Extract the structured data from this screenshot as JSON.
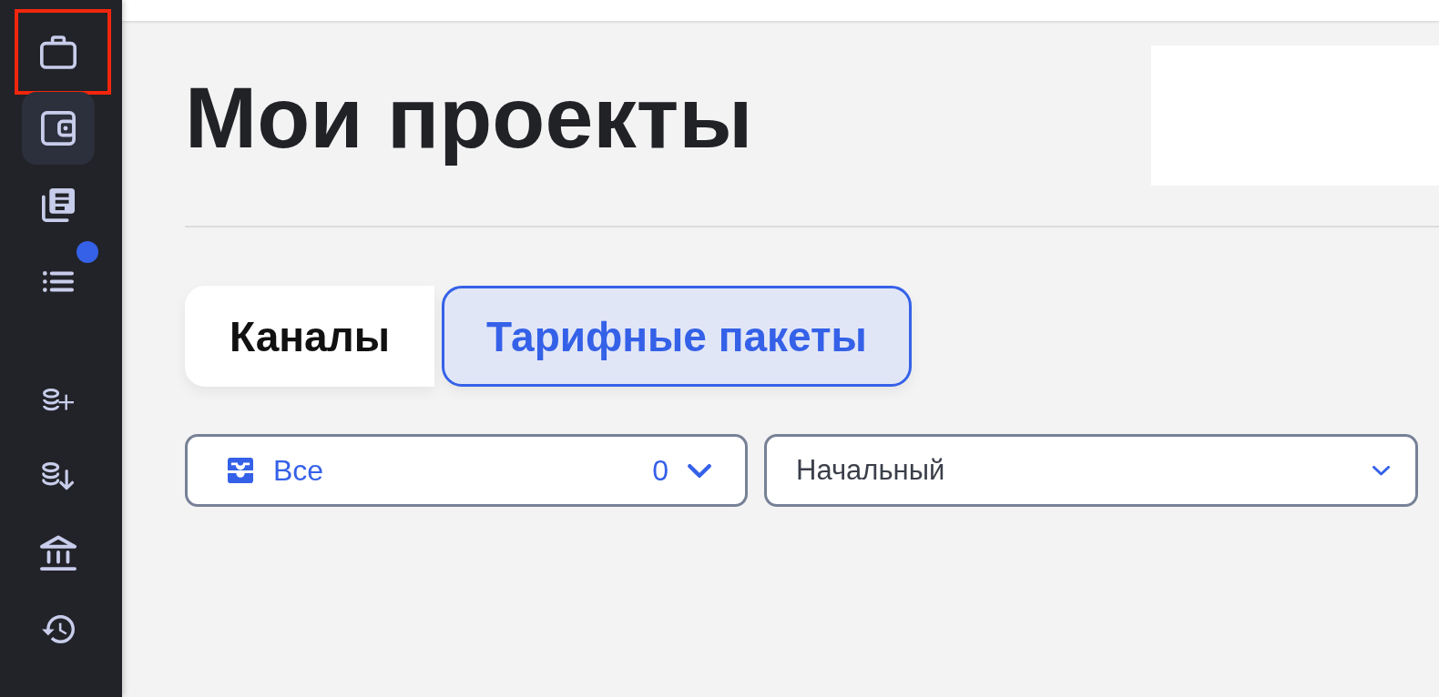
{
  "sidebar": {
    "groups": [
      {
        "items": [
          {
            "selected": false,
            "highlighted": true,
            "notification": false
          },
          {
            "selected": true,
            "highlighted": false,
            "notification": false
          },
          {
            "selected": false,
            "highlighted": false,
            "notification": false
          },
          {
            "selected": false,
            "highlighted": false,
            "notification": true
          }
        ]
      },
      {
        "items": [
          {
            "selected": false,
            "highlighted": false,
            "notification": false
          },
          {
            "selected": false,
            "highlighted": false,
            "notification": false
          },
          {
            "selected": false,
            "highlighted": false,
            "notification": false
          },
          {
            "selected": false,
            "highlighted": false,
            "notification": false
          }
        ]
      }
    ]
  },
  "page": {
    "title": "Мои проекты"
  },
  "tabs": [
    {
      "label": "Каналы",
      "selected": false
    },
    {
      "label": "Тарифные пакеты",
      "selected": true
    }
  ],
  "filters": [
    {
      "kind": "status",
      "value": "Все",
      "count": "0"
    },
    {
      "kind": "plan",
      "value": "Начальный"
    }
  ]
}
